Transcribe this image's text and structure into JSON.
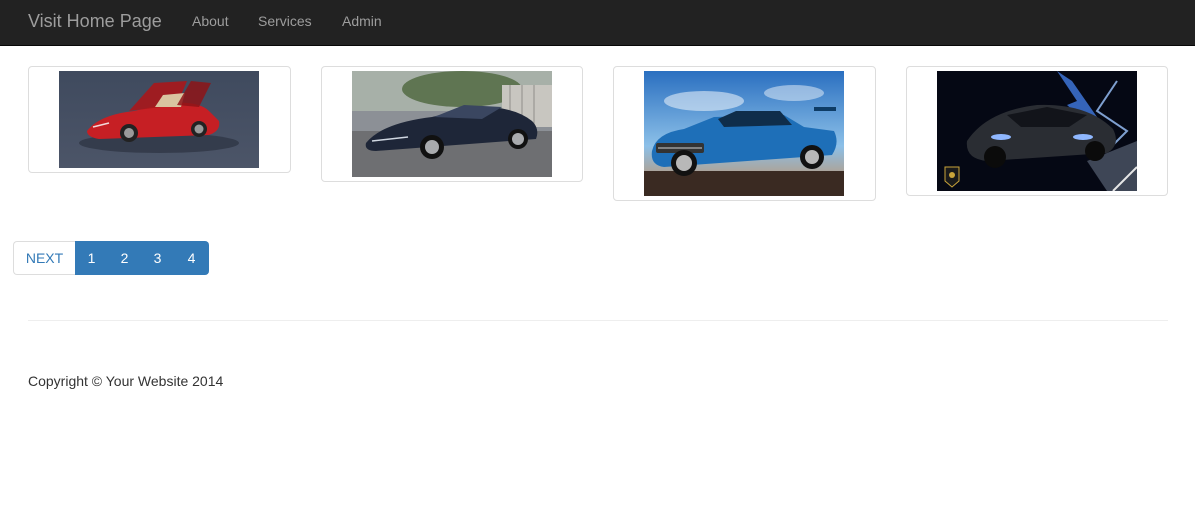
{
  "navbar": {
    "brand": "Visit Home Page",
    "links": [
      {
        "label": "About"
      },
      {
        "label": "Services"
      },
      {
        "label": "Admin"
      }
    ],
    "background_color": "#222222",
    "link_color": "#9d9d9d"
  },
  "gallery": {
    "items": [
      {
        "subject": "red sports car with gull-wing doors open"
      },
      {
        "subject": "dark blue luxury coupe"
      },
      {
        "subject": "blue muscle car"
      },
      {
        "subject": "black supercar with blue lightning"
      }
    ]
  },
  "pagination": {
    "next_label": "NEXT",
    "pages": [
      "1",
      "2",
      "3",
      "4"
    ],
    "accent_color": "#337ab7"
  },
  "footer": {
    "copyright": "Copyright © Your Website 2014"
  }
}
